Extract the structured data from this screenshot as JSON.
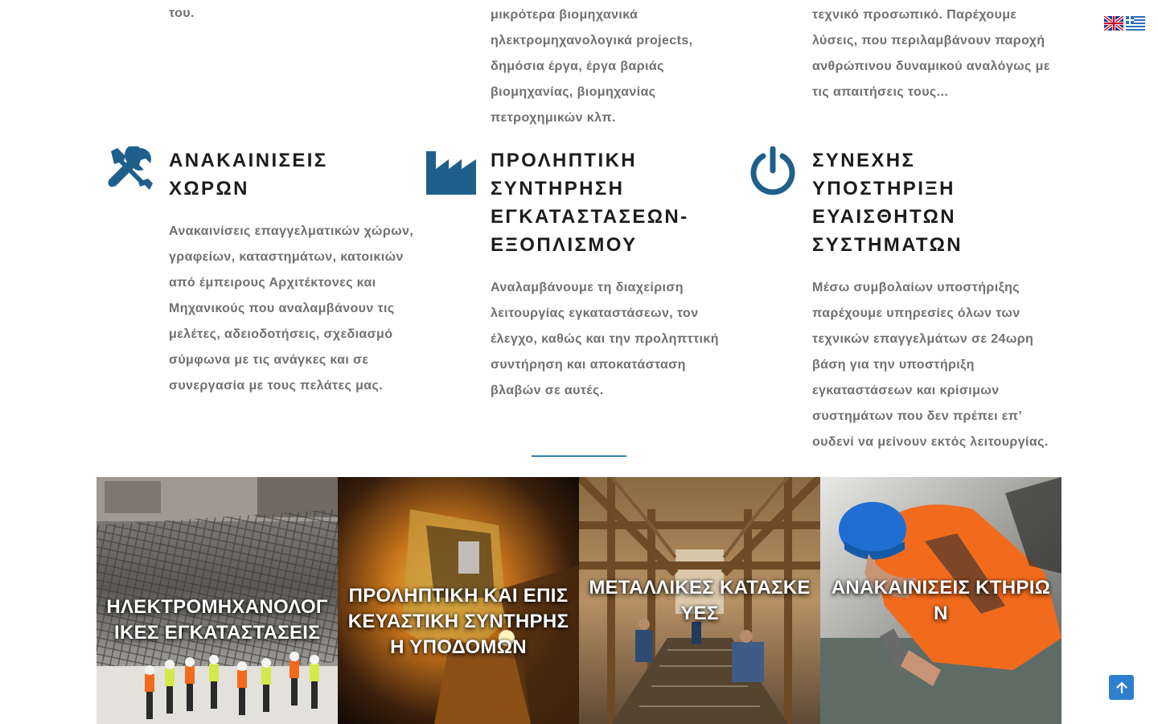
{
  "top_fragments": {
    "col1": [
      "του."
    ],
    "col2": [
      "μικρότερα βιομηχανικά",
      "ηλεκτρομηχανολογικά projects,",
      "δημόσια έργα, έργα βαριάς",
      "βιομηχανίας, βιομηχανίας",
      "πετροχημικών κλπ."
    ],
    "col3": [
      "τεχνικό προσωπικό. Παρέχουμε",
      "λύσεις, που περιλαμβάνουν παροχή",
      "ανθρώπινου δυναμικού αναλόγως με",
      "τις απαιτήσεις τους..."
    ]
  },
  "services": [
    {
      "icon": "tools-icon",
      "title": "ΑΝΑΚΑΙΝΙΣΕΙΣ ΧΩΡΩΝ",
      "description": "Ανακαινίσεις επαγγελματικών χώρων, γραφείων, καταστημάτων, κατοικιών από έμπειρους Αρχιτέκτονες και Μηχανικούς που αναλαμβάνουν τις μελέτες, αδειοδοτήσεις, σχεδιασμό σύμφωνα με τις ανάγκες και σε συνεργασία με τους πελάτες μας."
    },
    {
      "icon": "factory-icon",
      "title": "ΠΡΟΛΗΠΤΙΚΗ ΣΥΝΤΗΡΗΣΗ ΕΓΚΑΤΑΣΤΑΣΕΩΝ-ΕΞΟΠΛΙΣΜΟΥ",
      "description": "Αναλαμβάνουμε τη διαχείριση λειτουργίας εγκαταστάσεων, τον έλεγχο, καθώς και την προληπττική συντήρηση και αποκατάσταση βλαβών σε αυτές."
    },
    {
      "icon": "power-icon",
      "title": "ΣΥΝΕΧΗΣ ΥΠΟΣΤΗΡΙΞΗ ΕΥΑΙΣΘΗΤΩΝ ΣΥΣΤΗΜΑΤΩΝ",
      "description": "Μέσω συμβολαίων υποστήριξης παρέχουμε υπηρεσίες όλων των τεχνικών επαγγελμάτων σε 24ωρη βάση για την υποστήριξη εγκαταστάσεων και κρίσιμων συστημάτων που δεν πρέπει επ’ ουδενί να μείνουν εκτός λειτουργίας."
    }
  ],
  "language_flags": [
    "uk-flag-icon",
    "greek-flag-icon"
  ],
  "tiles": [
    {
      "title": "ΗΛΕΚΤΡΟΜΗΧΑΝΟΛΟΓΙΚΕΣ ΕΓΚΑΤΑΣΤΑΣΕΙΣ"
    },
    {
      "title": "ΠΡΟΛΗΠΤΙΚΗ ΚΑΙ ΕΠΙΣΚΕΥΑΣΤΙΚΗ ΣΥΝΤΗΡΗΣΗ ΥΠΟΔΟΜΩΝ"
    },
    {
      "title": "ΜΕΤΑΛΛΙΚΕΣ ΚΑΤΑΣΚΕΥΕΣ"
    },
    {
      "title": "ΑΝΑΚΑΙΝΙΣΕΙΣ ΚΤΗΡΙΩΝ"
    }
  ],
  "colors": {
    "accent": "#1f5f8b",
    "divider": "#2e7fb0",
    "scroll_button": "#2e7fcf"
  },
  "scroll_top_icon": "arrow-up-icon"
}
